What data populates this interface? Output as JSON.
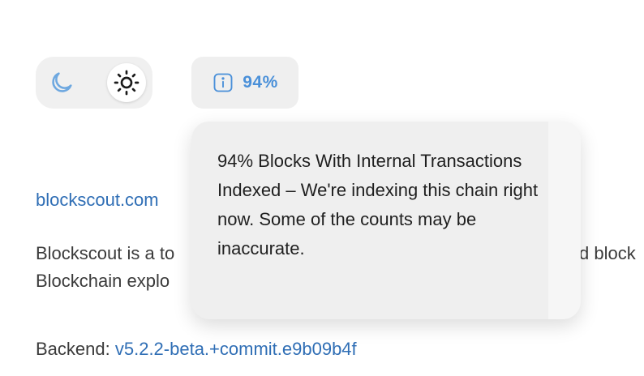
{
  "theme": {
    "dark_icon": "moon-icon",
    "light_icon": "sun-icon",
    "active": "light"
  },
  "indexing": {
    "icon": "info-icon",
    "percent_label": "94%"
  },
  "tooltip": {
    "text": "94% Blocks With Internal Transactions Indexed – We're indexing this chain right now. Some of the counts may be inaccurate."
  },
  "footer": {
    "link": "blockscout.com",
    "description_line1_start": "Blockscout is a to",
    "description_line1_end": "d block",
    "description_line2_start": "Blockchain explo",
    "backend_label": "Backend:",
    "backend_version": "v5.2.2-beta.+commit.e9b09b4f"
  },
  "colors": {
    "accent": "#4a90d9",
    "link": "#2f6eb5"
  }
}
